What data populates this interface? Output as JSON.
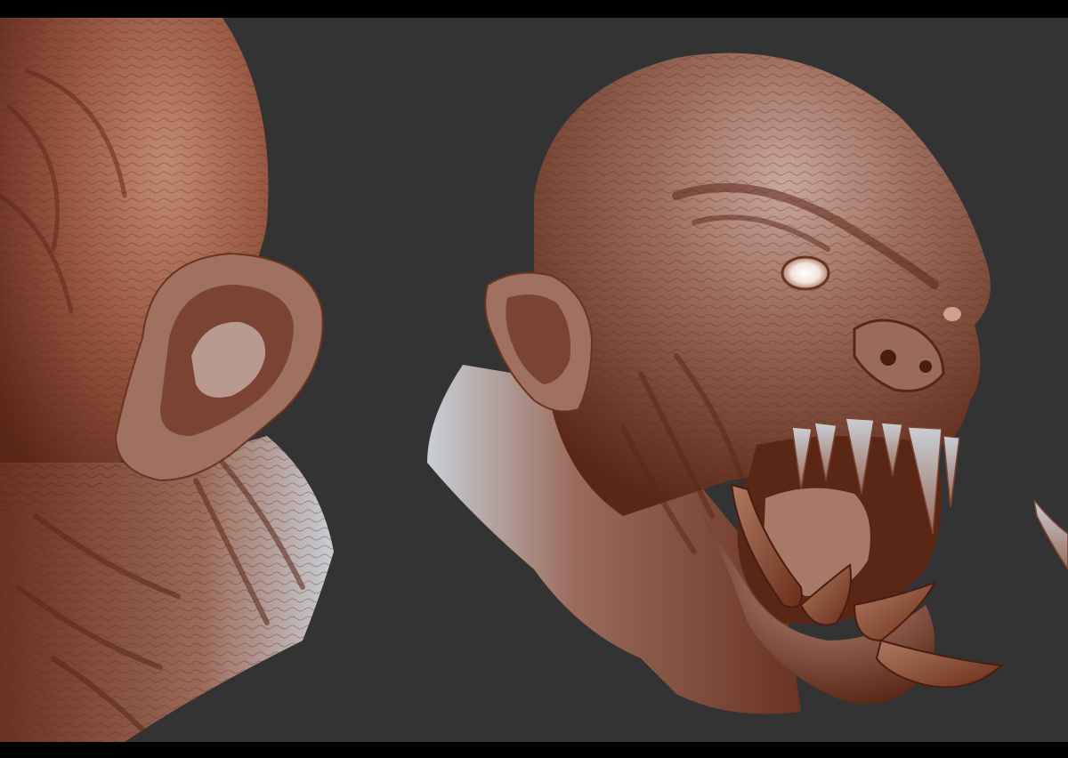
{
  "scene": {
    "background_color": "#333333",
    "letterbox_color": "#000000",
    "clay_base_color": "#9a5a45",
    "clay_highlight_color": "#c9cfd6",
    "clay_shadow_color": "#5a2615",
    "eye_color": "#f1e4dc",
    "subjects": [
      {
        "name": "creature-head-side-closeup",
        "view": "side close-up"
      },
      {
        "name": "creature-head-three-quarter",
        "view": "three-quarter"
      },
      {
        "name": "creature-head-partial-edge",
        "view": "partial"
      }
    ]
  }
}
